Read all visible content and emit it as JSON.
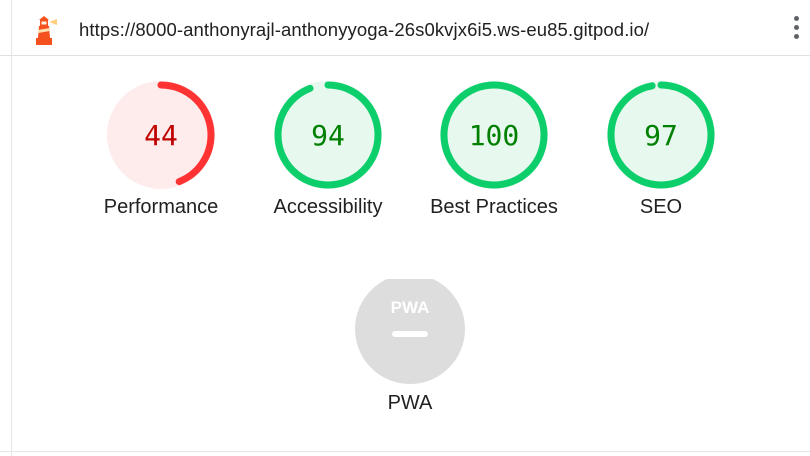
{
  "url": "https://8000-anthonyrajl-anthonyyoga-26s0kvjx6i5.ws-eu85.gitpod.io/",
  "icons": {
    "logo": "lighthouse-icon",
    "menu": "more-vertical-icon",
    "pwa": "pwa-badge-icon"
  },
  "colors": {
    "fail": "#ff3333",
    "fail_bg": "#fdeceb",
    "fail_text": "#c00000",
    "pass": "#0cce6b",
    "pass_bg": "#e7f8ee",
    "pass_text": "#008000",
    "pwa_bg": "#dddddd"
  },
  "gauges": [
    {
      "score": "44",
      "label": "Performance",
      "fraction": 0.44,
      "status": "fail"
    },
    {
      "score": "94",
      "label": "Accessibility",
      "fraction": 0.94,
      "status": "pass"
    },
    {
      "score": "100",
      "label": "Best Practices",
      "fraction": 1.0,
      "status": "pass"
    },
    {
      "score": "97",
      "label": "SEO",
      "fraction": 0.97,
      "status": "pass"
    }
  ],
  "pwa": {
    "badge_text": "PWA",
    "label": "PWA"
  }
}
